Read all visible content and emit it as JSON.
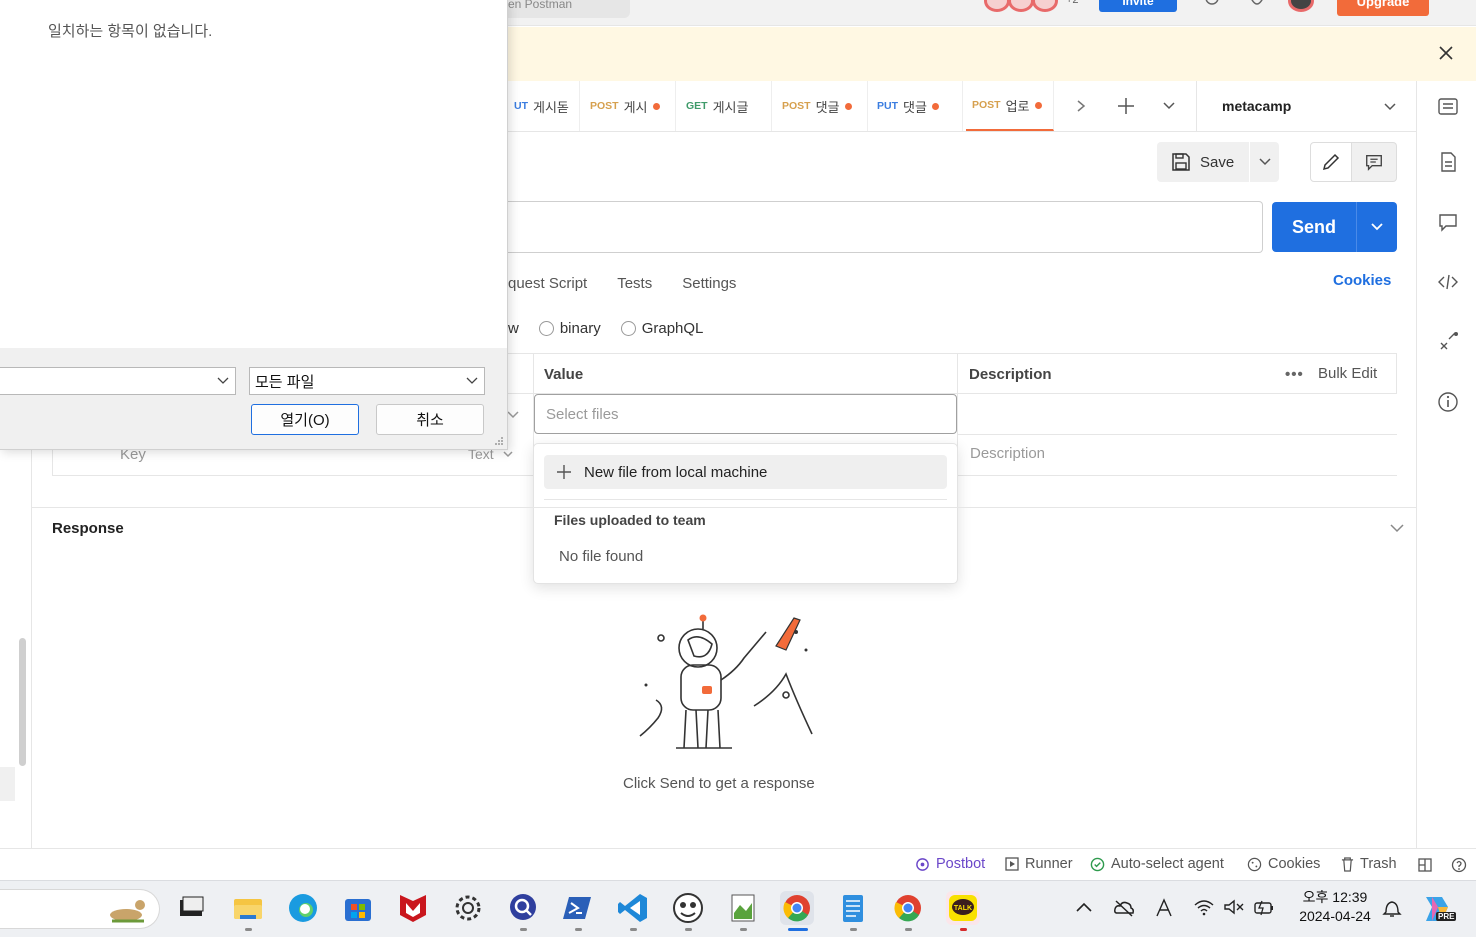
{
  "topbar": {
    "search_text": "en Postman",
    "avatar_count": "+2",
    "invite_label": "Invite",
    "upgrade_label": "Upgrade"
  },
  "tabs": [
    {
      "method": "PUT",
      "name": "게시돋",
      "method_label": "UT"
    },
    {
      "method": "POST",
      "name": "게시",
      "method_label": "POST"
    },
    {
      "method": "GET",
      "name": "게시글",
      "method_label": "GET"
    },
    {
      "method": "POST",
      "name": "댓글",
      "method_label": "POST"
    },
    {
      "method": "PUT",
      "name": "댓글",
      "method_label": "PUT"
    },
    {
      "method": "POST",
      "name": "업로",
      "method_label": "POST"
    }
  ],
  "environment": "metacamp",
  "toolbar": {
    "save_label": "Save"
  },
  "request": {
    "send_label": "Send",
    "tabs": [
      "quest Script",
      "Tests",
      "Settings"
    ],
    "cookies_label": "Cookies",
    "body_types": [
      "w",
      "binary",
      "GraphQL"
    ]
  },
  "table": {
    "headers": [
      "Value",
      "Description"
    ],
    "bulk_edit": "Bulk Edit",
    "select_files_placeholder": "Select files",
    "key_placeholder": "Key",
    "type_label": "Text",
    "description_placeholder": "Description"
  },
  "file_dropdown": {
    "new_file_label": "New file from local machine",
    "section_title": "Files uploaded to team",
    "empty_label": "No file found"
  },
  "response": {
    "title": "Response",
    "hint": "Click Send to get a response"
  },
  "statusbar": {
    "postbot": "Postbot",
    "runner": "Runner",
    "agent": "Auto-select agent",
    "cookies": "Cookies",
    "trash": "Trash"
  },
  "dialog": {
    "empty_message": "일치하는 항목이 없습니다.",
    "filetype_value": "모든 파일",
    "open_label": "열기(O)",
    "cancel_label": "취소"
  },
  "taskbar": {
    "time": "오후 12:39",
    "date": "2024-04-24",
    "copilot_badge": "PRE",
    "kakao_label": "TALK"
  },
  "colors": {
    "accent_blue": "#1f6fe0",
    "accent_orange": "#f26b3a",
    "banner_bg": "#fff8e3"
  }
}
